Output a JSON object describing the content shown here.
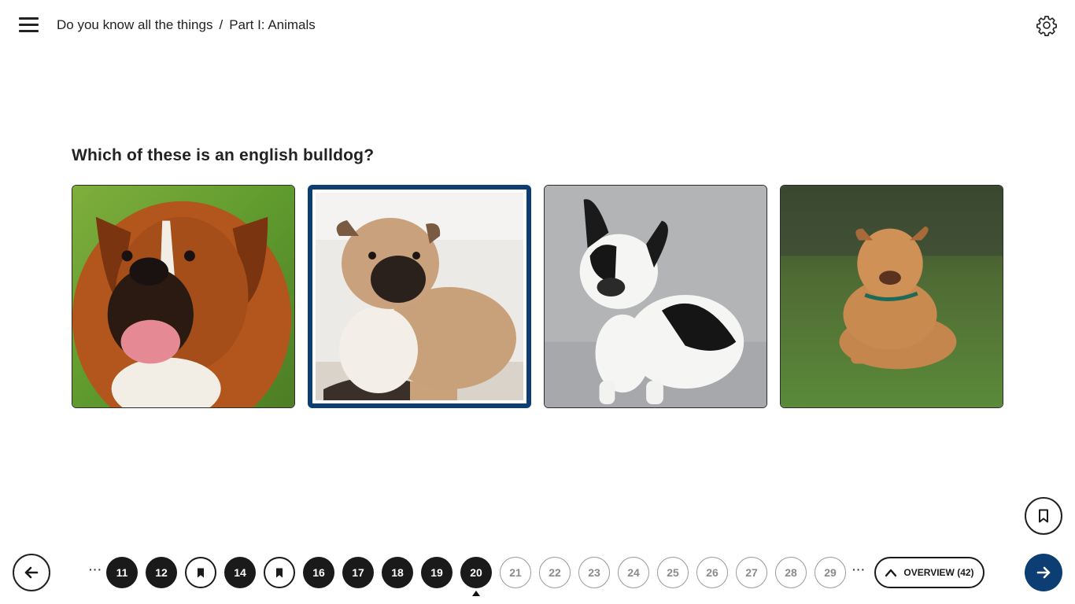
{
  "breadcrumb": {
    "course": "Do you know all the things",
    "separator": "/",
    "section": "Part I: Animals"
  },
  "header": {
    "menu_icon": "hamburger-menu-icon",
    "settings_icon": "gear-icon"
  },
  "question": {
    "text": "Which of these is an english bulldog?",
    "options": [
      {
        "id": "boxer",
        "selected": false
      },
      {
        "id": "english-bulldog",
        "selected": true
      },
      {
        "id": "french-bulldog",
        "selected": false
      },
      {
        "id": "pit-bull",
        "selected": false
      }
    ]
  },
  "colors": {
    "accent": "#0c3e74",
    "completed": "#1a1a1a",
    "unvisited_border": "#9a9a9a"
  },
  "pagination": {
    "leading_ellipsis": "···",
    "trailing_ellipsis": "···",
    "items": [
      {
        "label": "11",
        "state": "done"
      },
      {
        "label": "12",
        "state": "done"
      },
      {
        "label": "",
        "state": "bookmarked"
      },
      {
        "label": "14",
        "state": "done"
      },
      {
        "label": "",
        "state": "bookmarked"
      },
      {
        "label": "16",
        "state": "done"
      },
      {
        "label": "17",
        "state": "done"
      },
      {
        "label": "18",
        "state": "done"
      },
      {
        "label": "19",
        "state": "done"
      },
      {
        "label": "20",
        "state": "current"
      },
      {
        "label": "21",
        "state": "todo"
      },
      {
        "label": "22",
        "state": "todo"
      },
      {
        "label": "23",
        "state": "todo"
      },
      {
        "label": "24",
        "state": "todo"
      },
      {
        "label": "25",
        "state": "todo"
      },
      {
        "label": "26",
        "state": "todo"
      },
      {
        "label": "27",
        "state": "todo"
      },
      {
        "label": "28",
        "state": "todo"
      },
      {
        "label": "29",
        "state": "todo"
      }
    ],
    "overview_label": "OVERVIEW (42)"
  },
  "nav": {
    "back_icon": "arrow-left-icon",
    "next_icon": "arrow-right-icon",
    "bookmark_icon": "bookmark-icon"
  }
}
